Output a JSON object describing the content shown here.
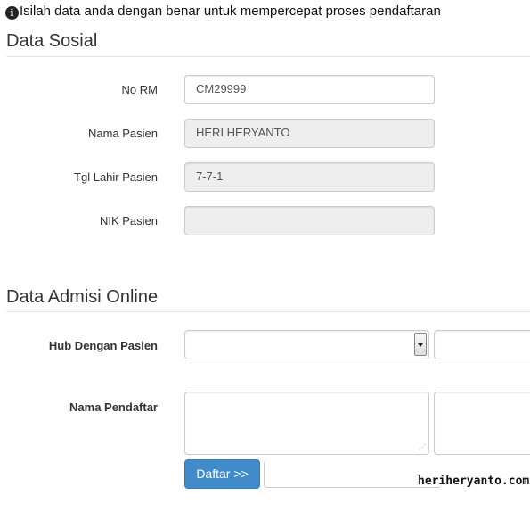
{
  "notice": {
    "icon": "info-icon",
    "text": "Isilah data anda dengan benar untuk mempercepat proses pendaftaran"
  },
  "data_sosial": {
    "title": "Data Sosial",
    "fields": {
      "no_rm": {
        "label": "No RM",
        "value": "CM29999"
      },
      "nama_pasien": {
        "label": "Nama Pasien",
        "value": "HERI HERYANTO"
      },
      "tgl_lahir": {
        "label": "Tgl Lahir Pasien",
        "value": "7-7-1"
      },
      "nik": {
        "label": "NIK Pasien",
        "value": ""
      }
    }
  },
  "data_admisi": {
    "title": "Data Admisi Online",
    "hub_dengan_pasien": {
      "label": "Hub Dengan Pasien",
      "value": ""
    },
    "nama_pendaftar": {
      "label": "Nama Pendaftar",
      "value": ""
    },
    "submit_label": "Daftar >>"
  },
  "watermark": "heriheryanto.com"
}
